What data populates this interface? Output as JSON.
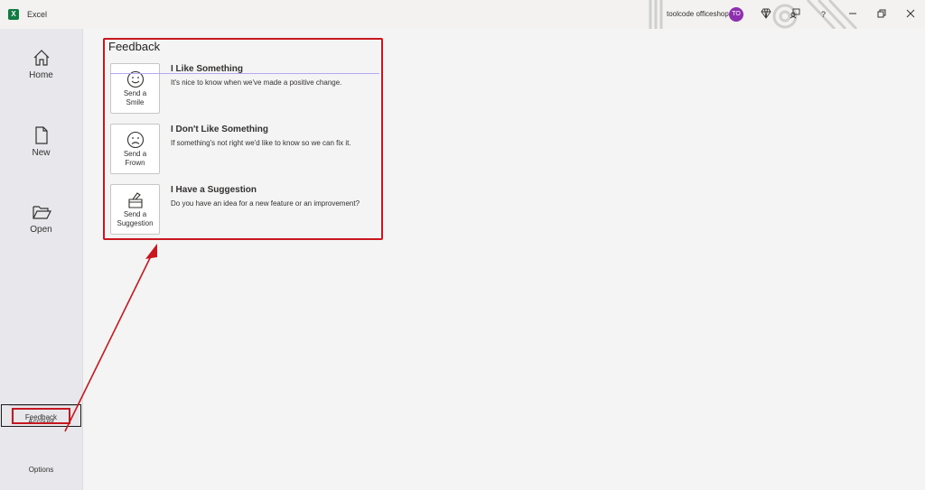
{
  "titlebar": {
    "app_name": "Excel",
    "app_icon_letter": "X",
    "user_name": "toolcode officeshop",
    "avatar_initials": "TO",
    "help_label": "?"
  },
  "sidebar": {
    "home": "Home",
    "new": "New",
    "open": "Open",
    "account": "Account",
    "feedback": "Feedback",
    "options": "Options"
  },
  "feedback": {
    "title": "Feedback",
    "options": [
      {
        "button_line1": "Send a",
        "button_line2": "Smile",
        "title": "I Like Something",
        "description": "It's nice to know when we've made a positive change."
      },
      {
        "button_line1": "Send a",
        "button_line2": "Frown",
        "title": "I Don't Like Something",
        "description": "If something's not right we'd like to know so we can fix it."
      },
      {
        "button_line1": "Send a",
        "button_line2": "Suggestion",
        "title": "I Have a Suggestion",
        "description": "Do you have an idea for a new feature or an improvement?"
      }
    ]
  },
  "colors": {
    "highlight": "#c8171e",
    "excel_green": "#107c41",
    "avatar": "#8e2fb0"
  }
}
